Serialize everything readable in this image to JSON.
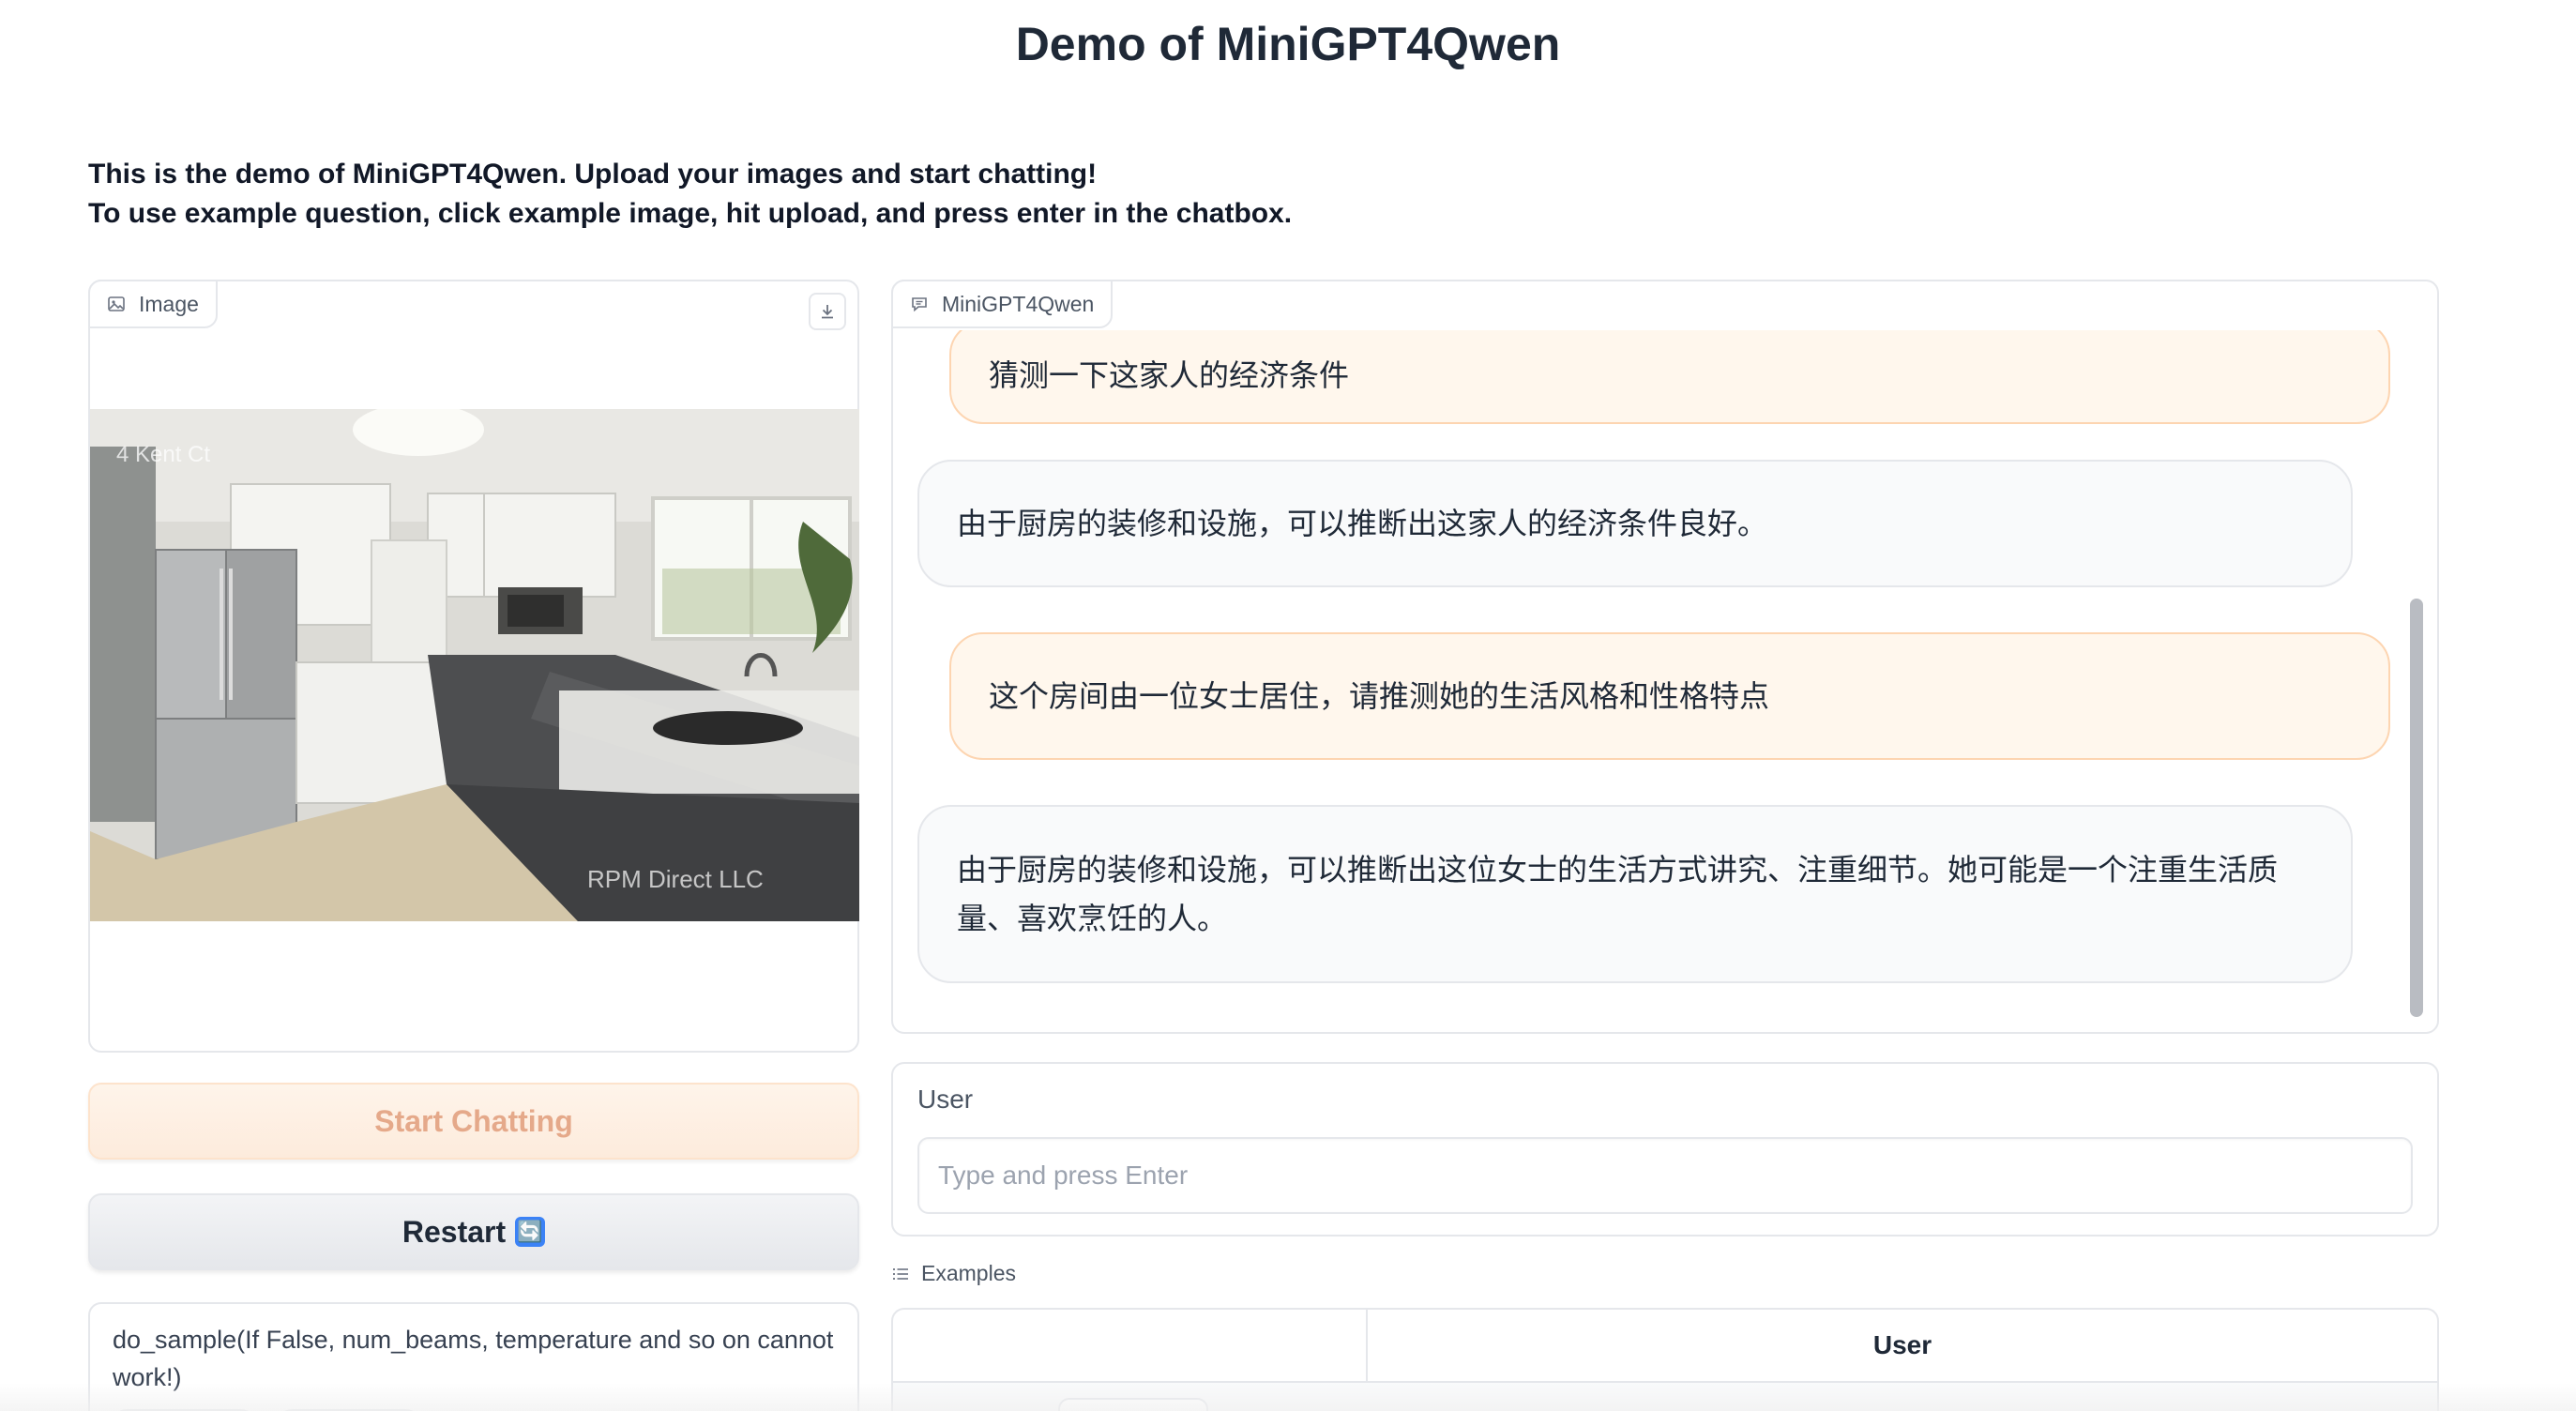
{
  "page": {
    "title": "Demo of MiniGPT4Qwen",
    "intro_line1": "This is the demo of MiniGPT4Qwen. Upload your images and start chatting!",
    "intro_line2": "To use example question, click example image, hit upload, and press enter in the chatbox."
  },
  "image_panel": {
    "label": "Image",
    "label_icon": "image-icon",
    "download_icon": "download-icon",
    "photo_watermark_top": "4 Kent Ct",
    "photo_watermark_bottom": "RPM Direct LLC"
  },
  "buttons": {
    "start_label": "Start Chatting",
    "restart_label": "Restart",
    "restart_emoji": "🔄"
  },
  "sampling": {
    "description": "do_sample(If False, num_beams, temperature and so on cannot work!)"
  },
  "chatbot": {
    "label": "MiniGPT4Qwen",
    "label_icon": "chat-icon",
    "messages": [
      {
        "role": "user",
        "text": "猜测一下这家人的经济条件"
      },
      {
        "role": "bot",
        "text": "由于厨房的装修和设施，可以推断出这家人的经济条件良好。"
      },
      {
        "role": "user",
        "text": "这个房间由一位女士居住，请推测她的生活风格和性格特点"
      },
      {
        "role": "bot",
        "text": "由于厨房的装修和设施，可以推断出这位女士的生活方式讲究、注重细节。她可能是一个注重生活质量、喜欢烹饪的人。"
      }
    ]
  },
  "user_input": {
    "label": "User",
    "placeholder": "Type and press Enter",
    "value": ""
  },
  "examples": {
    "label": "Examples",
    "label_icon": "list-icon",
    "column_user": "User"
  },
  "colors": {
    "user_bubble_bg": "#fff7ed",
    "user_bubble_border": "#fdd5b1",
    "start_button_text": "#e5a98a"
  }
}
